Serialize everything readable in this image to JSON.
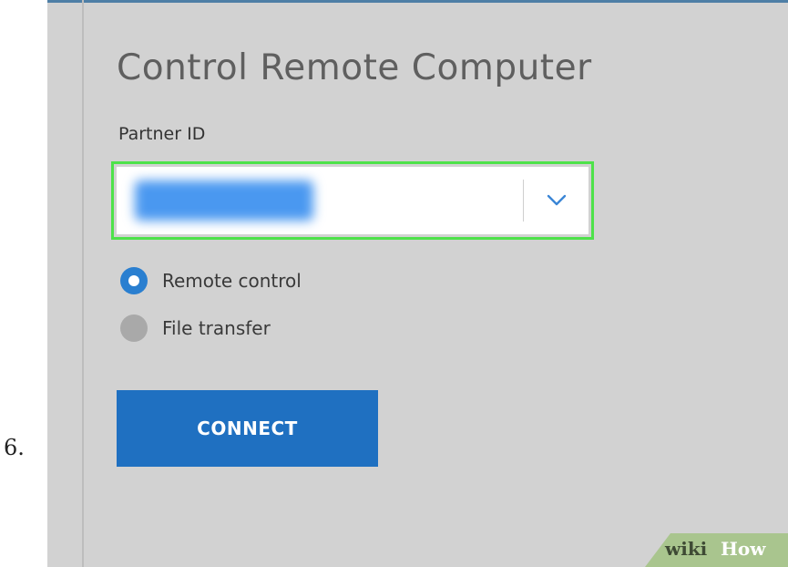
{
  "step": {
    "number": "6."
  },
  "dialog": {
    "title": "Control Remote Computer",
    "partner_id_label": "Partner ID",
    "partner_id_value": "",
    "dropdown_icon": "chevron-down-icon",
    "radios": [
      {
        "label": "Remote control",
        "selected": true
      },
      {
        "label": "File transfer",
        "selected": false
      }
    ],
    "connect_label": "CONNECT"
  },
  "watermark": {
    "wiki": "wiki",
    "how": "How"
  },
  "colors": {
    "panel_bg": "#d2d2d2",
    "accent_blue": "#1f70c1",
    "highlight_green": "#4ee24a",
    "radio_selected": "#2a7fd0",
    "radio_unselected": "#a9a9a9",
    "watermark_green": "#a9c58e"
  }
}
